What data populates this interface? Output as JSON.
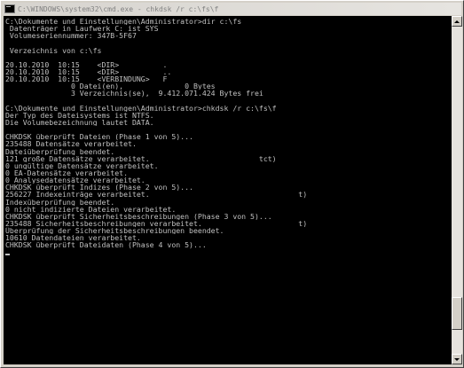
{
  "window": {
    "title": "C:\\WINDOWS\\system32\\cmd.exe - chkdsk /r c:\\fs\\f",
    "icon": "cmd-console-icon"
  },
  "console": {
    "lines": [
      "C:\\Dokumente und Einstellungen\\Administrator>dir c:\\fs",
      " Datenträger in Laufwerk C: ist SYS",
      " Volumeseriennummer: 347B-5F67",
      "",
      " Verzeichnis von c:\\fs",
      "",
      "20.10.2010  10:15    <DIR>          .",
      "20.10.2010  10:15    <DIR>          ..",
      "20.10.2010  10:15    <VERBINDUNG>   F",
      "               0 Datei(en),              0 Bytes",
      "               3 Verzeichnis(se),  9.412.071.424 Bytes frei",
      "",
      "C:\\Dokumente und Einstellungen\\Administrator>chkdsk /r c:\\fs\\f",
      "Der Typ des Dateisystems ist NTFS.",
      "Die Volumebezeichnung lautet DATA.",
      "",
      "CHKDSK überprüft Dateien (Phase 1 von 5)...",
      "235488 Datensätze verarbeitet.",
      "Dateiüberprüfung beendet.",
      "121 große Datensätze verarbeitet.                         tct)",
      "0 ungültige Datensätze verarbeitet.",
      "0 EA-Datensätze verarbeitet.",
      "0 Analysedatensätze verarbeitet.",
      "CHKDSK überprüft Indizes (Phase 2 von 5)...",
      "256227 Indexeinträge verarbeitet.                                  t)",
      "Indexüberprüfung beendet.",
      "0 nicht indizierte Dateien verarbeitet.",
      "CHKDSK überprüft Sicherheitsbeschreibungen (Phase 3 von 5)...",
      "235488 Sicherheitsbeschreibungen verarbeitet.                      t)",
      "Überprüfung der Sicherheitsbeschreibungen beendet.",
      "10610 Datendateien verarbeitet.",
      "CHKDSK überprüft Dateidaten (Phase 4 von 5)..."
    ]
  },
  "scrollbar": {
    "position": 0.92,
    "visible_fraction": 0.1
  }
}
